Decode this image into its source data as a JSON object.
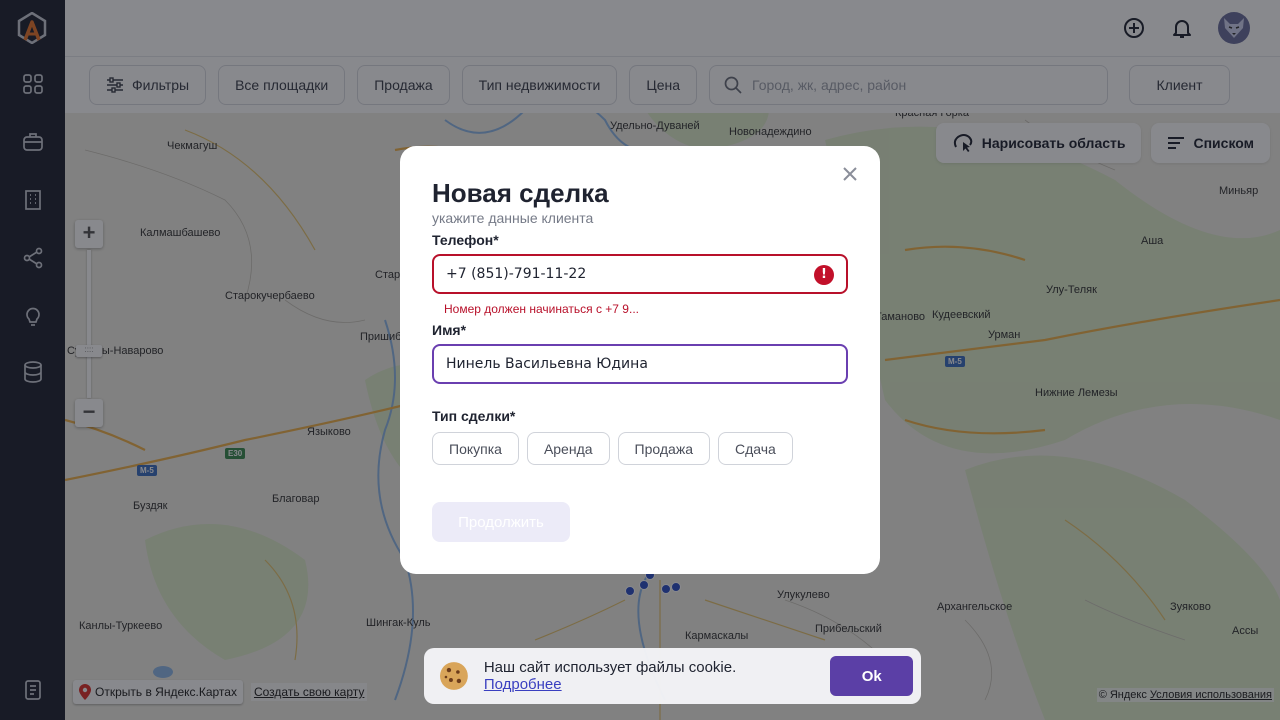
{
  "header": {
    "icons": [
      "plus-circle-icon",
      "bell-icon",
      "avatar-wolf"
    ]
  },
  "filters": {
    "filters_label": "Фильтры",
    "all_platforms": "Все площадки",
    "sale": "Продажа",
    "property_type": "Тип недвижимости",
    "price": "Цена",
    "search_placeholder": "Город, жк, адрес, район",
    "client": "Клиент"
  },
  "map": {
    "draw_area": "Нарисовать область",
    "list": "Списком",
    "open_yandex": "Открыть в Яндекс.Картах",
    "create_map": "Создать свою карту",
    "copyright": "© Яндекс",
    "terms": "Условия использования",
    "places": {
      "chekmagush": "Чекмагуш",
      "udelno": "Удельно-Дуваней",
      "novonadezhdino": "Новонадеждино",
      "krasnaya_gorka": "Красная Горка",
      "minyar": "Миньяр",
      "kalmashbashevo": "Калмашбашево",
      "starokuchervaevo": "Старокучербаево",
      "star": "Стар",
      "prishib": "Пришиб",
      "avarovo": "Суккулы-Наварово",
      "asha": "Аша",
      "ulu_telyak": "Улу-Теляк",
      "kudeevsky": "Кудеевский",
      "manovo": "Таманово",
      "urman": "Урман",
      "nizhnie_lemezy": "Нижние Лемезы",
      "yazykovo": "Языково",
      "blagovar": "Благовар",
      "buzdyak": "Буздяк",
      "shingak": "Шингак-Куль",
      "ulukulevo": "Улукулево",
      "arkhangelskoe": "Архангельское",
      "zuyakovo": "Зуяково",
      "kanly": "Канлы-Туркеево",
      "karmaskaly": "Кармаскалы",
      "pribelsky": "Прибельский",
      "assy": "Ассы"
    },
    "routes": {
      "m5_a": "М-5",
      "m5_b": "М-5",
      "e30": "E30"
    }
  },
  "modal": {
    "title": "Новая сделка",
    "subtitle": "укажите данные клиента",
    "phone_label": "Телефон*",
    "phone_value": "+7 (851)-791-11-22",
    "phone_error": "Номер должен начинаться с +7 9...",
    "name_label": "Имя*",
    "name_value": "Нинель Васильевна Юдина",
    "deal_type_label": "Тип сделки*",
    "deal_types": [
      "Покупка",
      "Аренда",
      "Продажа",
      "Сдача"
    ],
    "continue": "Продолжить"
  },
  "cookie": {
    "text": "Наш сайт использует файлы cookie.",
    "more": "Подробнее",
    "ok": "Ok"
  },
  "colors": {
    "sidebar": "#1e2230",
    "accent": "#5b3fa6",
    "error": "#b8102a",
    "focus_border": "#6a3fb0",
    "logo_orange": "#e8742a"
  }
}
